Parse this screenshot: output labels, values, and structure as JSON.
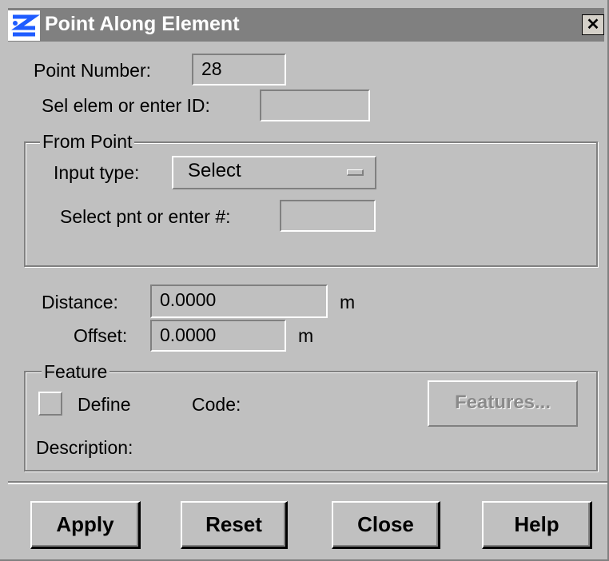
{
  "window": {
    "title": "Point Along Element",
    "close_glyph": "✕"
  },
  "point_number": {
    "label": "Point Number:",
    "value": "28"
  },
  "sel_elem": {
    "label": "Sel elem or enter ID:",
    "value": ""
  },
  "from_point": {
    "group_title": "From Point",
    "input_type_label": "Input type:",
    "input_type_value": "Select",
    "select_pnt_label": "Select pnt or enter #:",
    "select_pnt_value": ""
  },
  "distance": {
    "label": "Distance:",
    "value": "0.0000",
    "unit": "m"
  },
  "offset": {
    "label": "Offset:",
    "value": "0.0000",
    "unit": "m"
  },
  "feature": {
    "group_title": "Feature",
    "define_label": "Define",
    "define_checked": false,
    "code_label": "Code:",
    "features_button": "Features...",
    "description_label": "Description:"
  },
  "buttons": {
    "apply": "Apply",
    "reset": "Reset",
    "close": "Close",
    "help": "Help"
  },
  "colors": {
    "face": "#c0c0c0",
    "titlebar": "#808080",
    "shadow": "#808080",
    "highlight": "#ffffff",
    "icon_accent": "#1f5cff"
  }
}
